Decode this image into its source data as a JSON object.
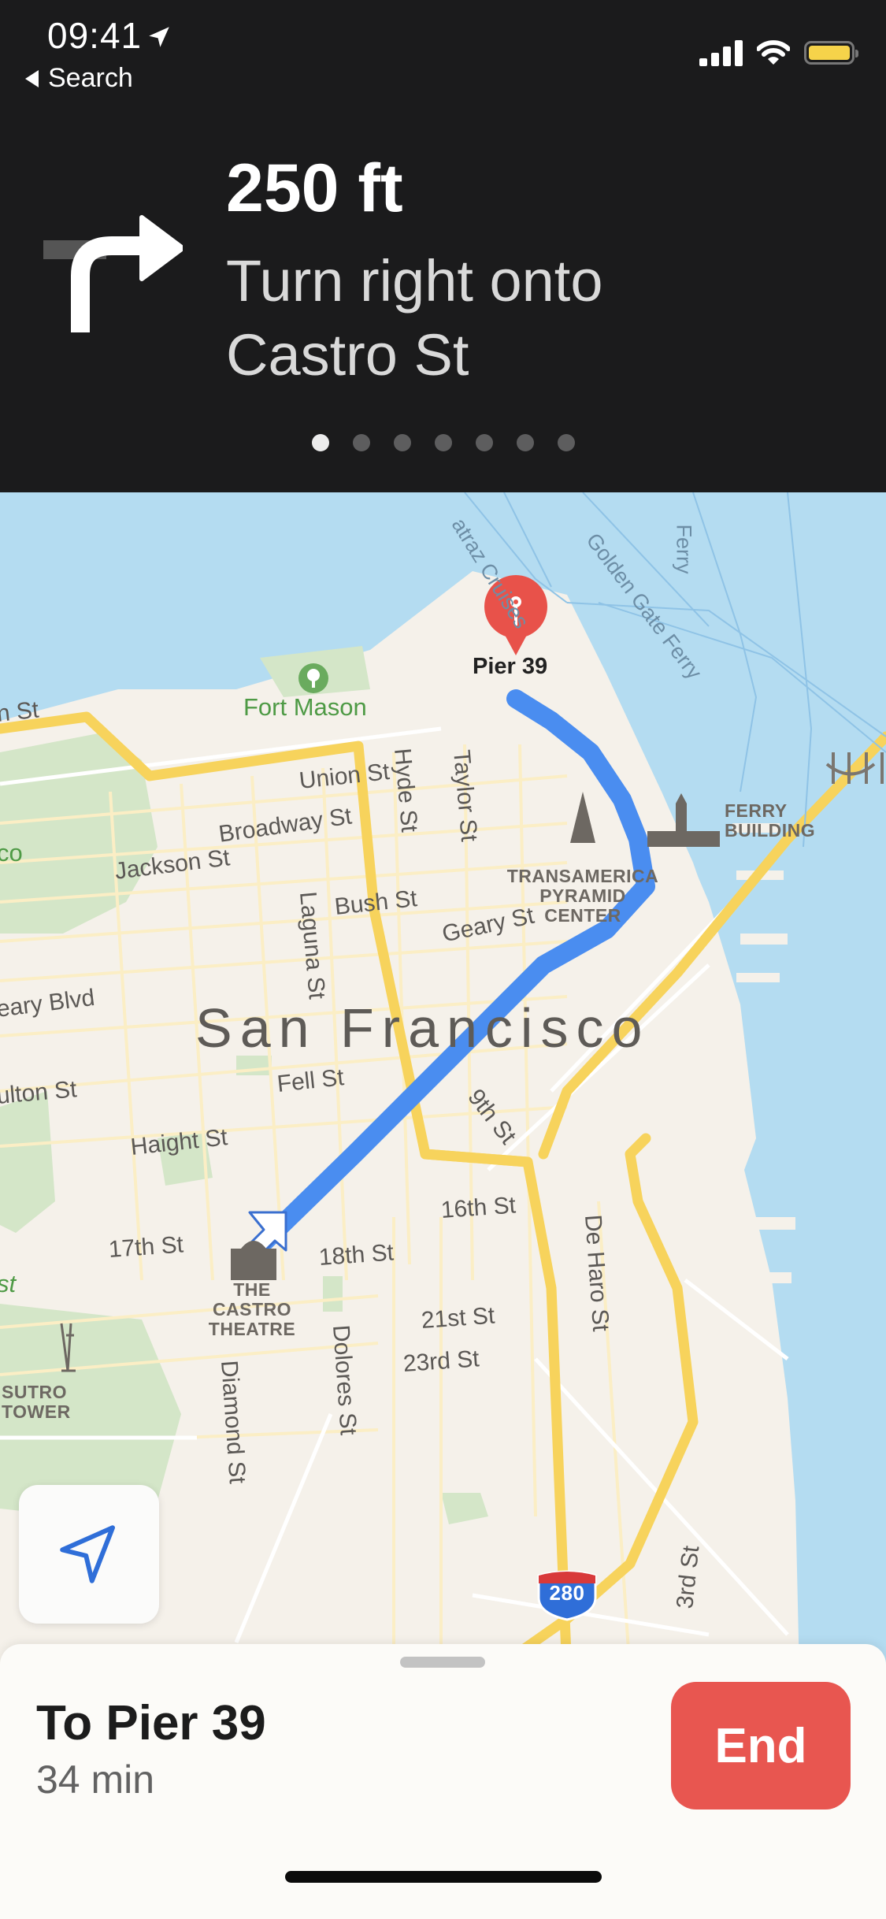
{
  "status_bar": {
    "time": "09:41",
    "location_icon": "location-arrow-icon",
    "back_label": "Search",
    "signal_bars": 4,
    "battery_color": "#f6d34a"
  },
  "maneuver": {
    "icon": "turn-right-arrow-icon",
    "distance": "250 ft",
    "instruction_line1": "Turn right onto",
    "instruction_line2": "Castro St",
    "step_count": 7,
    "current_step": 1
  },
  "map": {
    "city_label": "San Francisco",
    "destination_pin_label": "Pier 39",
    "park_labels": [
      "Fort Mason"
    ],
    "street_labels": [
      "n St",
      "Union St",
      "Broadway St",
      "Jackson St",
      "Hyde St",
      "Taylor St",
      "Laguna St",
      "Bush St",
      "Geary St",
      "eary Blvd",
      "Fell St",
      "ulton St",
      "Haight St",
      "9th St",
      "16th St",
      "17th St",
      "18th St",
      "21st St",
      "23rd St",
      "Dolores St",
      "Diamond St",
      "De Haro St",
      "3rd St"
    ],
    "ferry_labels": [
      "atraz Cruises",
      "Golden Gate Ferry",
      "Ferry"
    ],
    "poi_labels": {
      "transamerica": "TRANSAMERICA PYRAMID CENTER",
      "ferry_building": "FERRY BUILDING",
      "castro_theatre": "THE CASTRO THEATRE",
      "sutro_tower": "SUTRO TOWER"
    },
    "edge_labels": [
      "co",
      "st"
    ],
    "highway_shield": "280",
    "route_color": "#4a8df0",
    "pin_color": "#e8524a"
  },
  "recenter_button": {
    "icon": "location-arrow-outline-icon"
  },
  "trip_sheet": {
    "destination": "To Pier 39",
    "eta": "34 min",
    "end_label": "End",
    "end_color": "#e85650"
  }
}
